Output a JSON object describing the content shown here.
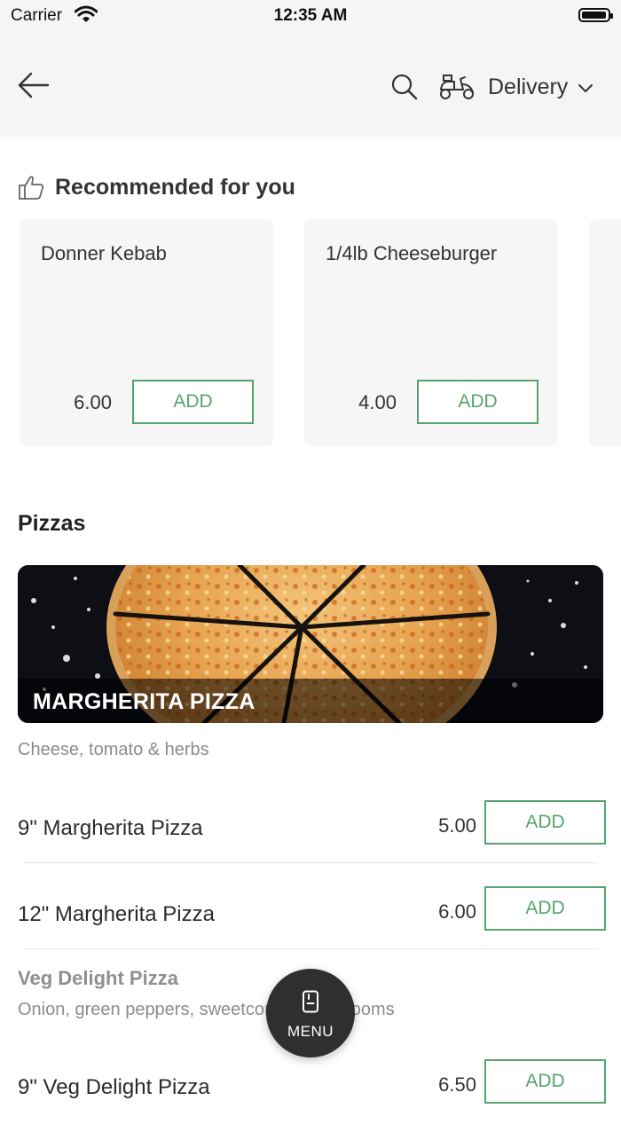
{
  "status_bar": {
    "carrier": "Carrier",
    "time": "12:35 AM"
  },
  "nav": {
    "delivery_label": "Delivery"
  },
  "recommended": {
    "title": "Recommended for you",
    "items": [
      {
        "name": "Donner Kebab",
        "price": "6.00",
        "add_label": "ADD"
      },
      {
        "name": "1/4lb Cheeseburger",
        "price": "4.00",
        "add_label": "ADD"
      }
    ]
  },
  "pizzas": {
    "section_title": "Pizzas",
    "banner_title": "MARGHERITA PIZZA",
    "banner_description": "Cheese, tomato & herbs",
    "items": [
      {
        "name": "9\" Margherita Pizza",
        "price": "5.00",
        "add_label": "ADD"
      },
      {
        "name": "12\" Margherita Pizza",
        "price": "6.00",
        "add_label": "ADD"
      }
    ],
    "veg_group": {
      "title": "Veg Delight Pizza",
      "description": "Onion, green peppers, sweetcorn & mushrooms",
      "items": [
        {
          "name": "9\" Veg Delight Pizza",
          "price": "6.50",
          "add_label": "ADD"
        }
      ]
    }
  },
  "menu_button": {
    "label": "MENU"
  },
  "colors": {
    "accent": "#55a46c",
    "nav_background": "#f5f5f5",
    "card_background": "#f6f6f6",
    "fab": "#2f2f2f"
  },
  "icons": [
    "wifi-icon",
    "battery-icon",
    "back-arrow-icon",
    "search-icon",
    "scooter-icon",
    "chevron-down-icon",
    "thumbs-up-icon",
    "menu-book-icon"
  ]
}
